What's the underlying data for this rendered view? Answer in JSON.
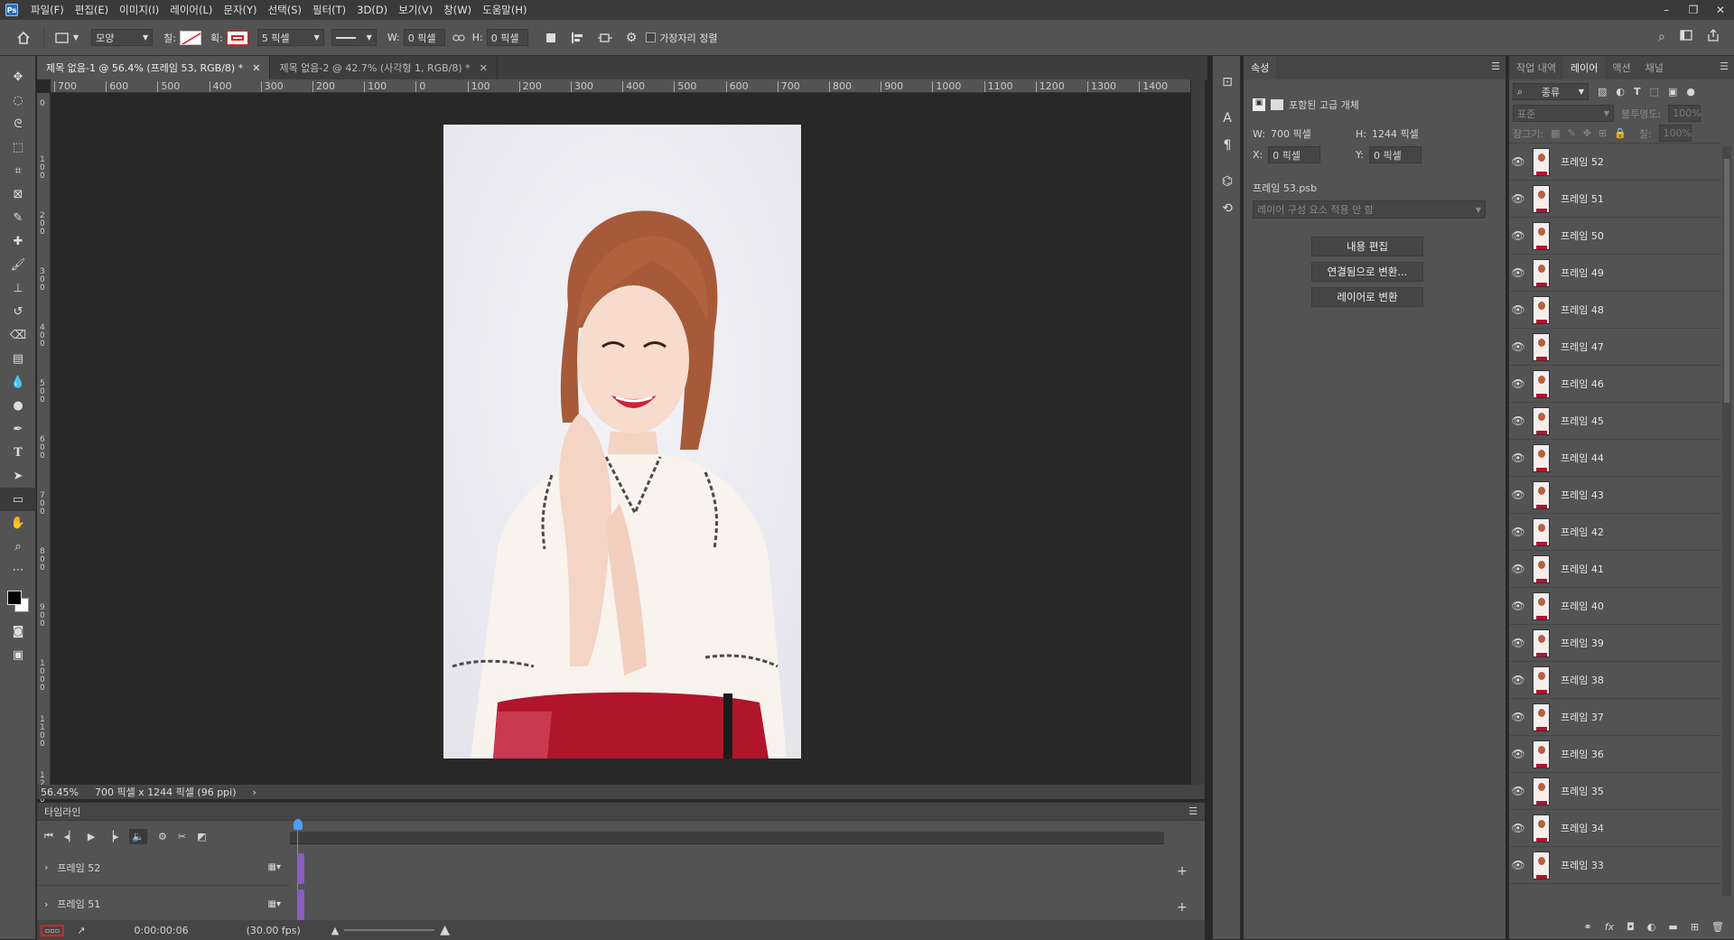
{
  "menu": {
    "logo": "Ps",
    "items": [
      "파일(F)",
      "편집(E)",
      "이미지(I)",
      "레이어(L)",
      "문자(Y)",
      "선택(S)",
      "필터(T)",
      "3D(D)",
      "보기(V)",
      "창(W)",
      "도움말(H)"
    ]
  },
  "window_controls": [
    "–",
    "❐",
    "✕"
  ],
  "options": {
    "shape_mode": "모양",
    "fill_label": "칠:",
    "stroke_label": "획:",
    "stroke_width": "5 픽셀",
    "w_label": "W:",
    "w_value": "0 픽셀",
    "h_label": "H:",
    "h_value": "0 픽셀",
    "align_edges": "가장자리 정렬"
  },
  "tabs": [
    {
      "label": "제목 없음-1 @ 56.4% (프레임 53, RGB/8) *",
      "active": true
    },
    {
      "label": "제목 없음-2 @ 42.7% (사각형 1, RGB/8) *",
      "active": false
    }
  ],
  "ruler": {
    "top_ticks": [
      "700",
      "600",
      "500",
      "400",
      "300",
      "200",
      "100",
      "0",
      "100",
      "200",
      "300",
      "400",
      "500",
      "600",
      "700",
      "800",
      "900",
      "1000",
      "1100",
      "1200",
      "1300",
      "1400"
    ],
    "left_ticks": [
      "0",
      "1\n0\n0",
      "2\n0\n0",
      "3\n0\n0",
      "4\n0\n0",
      "5\n0\n0",
      "6\n0\n0",
      "7\n0\n0",
      "8\n0\n0",
      "9\n0\n0",
      "1\n0\n0\n0",
      "1\n1\n0\n0",
      "1\n2\n0\n0"
    ]
  },
  "status": {
    "zoom": "56.45%",
    "doc_info": "700 픽셀 x 1244 픽셀 (96 ppi)"
  },
  "timeline": {
    "title": "타임라인",
    "tracks": [
      "프레임 52",
      "프레임 51"
    ],
    "timecode": "0:00:00:06",
    "fps": "(30.00 fps)"
  },
  "properties": {
    "tab": "속성",
    "type_label": "포함된 고급 개체",
    "w_label": "W:",
    "w_value": "700 픽셀",
    "h_label": "H:",
    "h_value": "1244 픽셀",
    "x_label": "X:",
    "x_value": "0 픽셀",
    "y_label": "Y:",
    "y_value": "0 픽셀",
    "filename": "프레임 53.psb",
    "comp_placeholder": "레이어 구성 요소 적용 안 함",
    "btn_edit": "내용 편집",
    "btn_linked": "연결됨으로 변환...",
    "btn_layers": "레이어로 변환"
  },
  "layers_panel": {
    "tabs": [
      "작업 내역",
      "레이어",
      "액션",
      "채널"
    ],
    "active_tab": "레이어",
    "filter_kind": "종류",
    "blend_mode": "표준",
    "opacity_label": "불투명도:",
    "opacity_value": "100%",
    "lock_label": "잠그기:",
    "fill_label": "칠:",
    "fill_value": "100%",
    "layers": [
      "프레임 52",
      "프레임 51",
      "프레임 50",
      "프레임 49",
      "프레임 48",
      "프레임 47",
      "프레임 46",
      "프레임 45",
      "프레임 44",
      "프레임 43",
      "프레임 42",
      "프레임 41",
      "프레임 40",
      "프레임 39",
      "프레임 38",
      "프레임 37",
      "프레임 36",
      "프레임 35",
      "프레임 34",
      "프레임 33"
    ]
  },
  "colors": {
    "accent_red": "#e02020",
    "timeline_bar": "#8a5cc2",
    "playhead": "#4a9eff"
  }
}
